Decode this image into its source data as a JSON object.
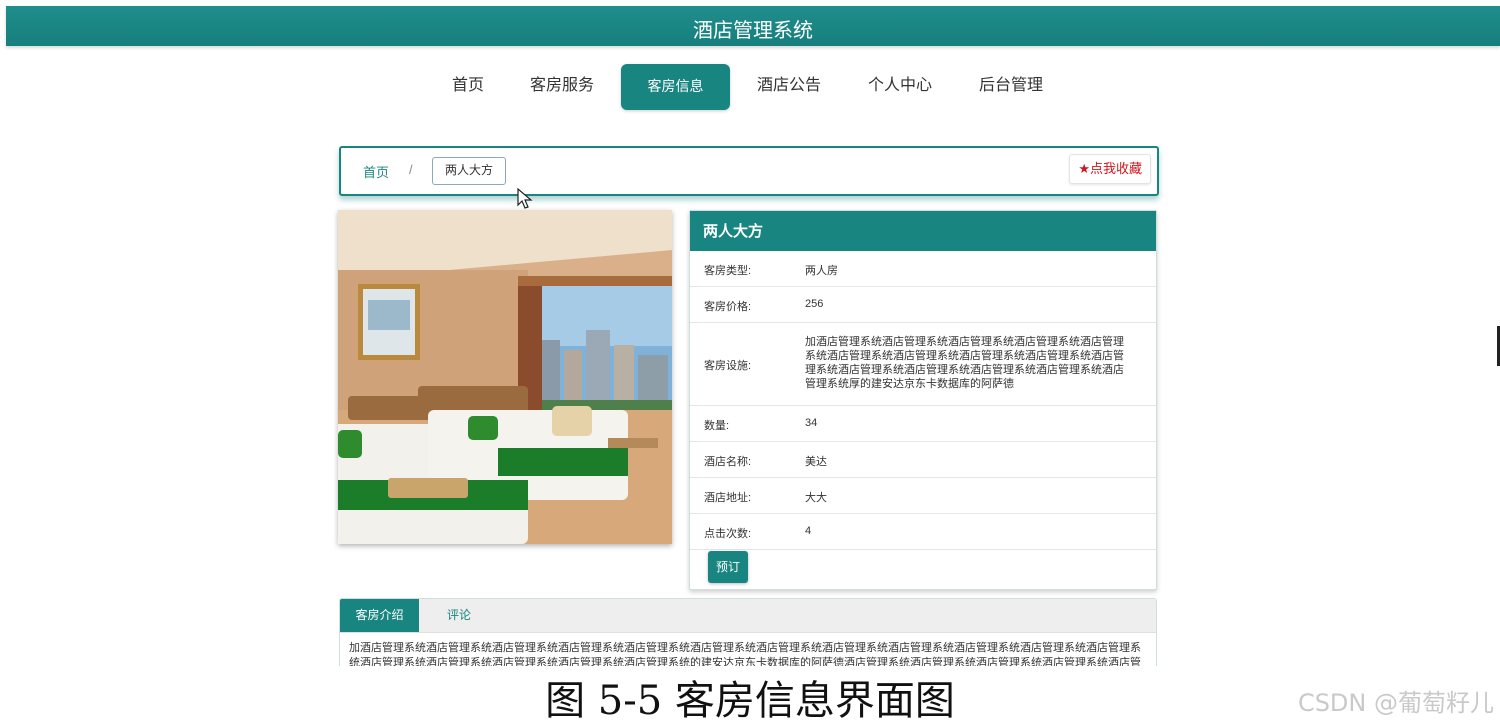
{
  "header": {
    "title": "酒店管理系统"
  },
  "nav": {
    "items": [
      {
        "label": "首页"
      },
      {
        "label": "客房服务"
      },
      {
        "label": "客房信息"
      },
      {
        "label": "酒店公告"
      },
      {
        "label": "个人中心"
      },
      {
        "label": "后台管理"
      }
    ],
    "active_index": 2
  },
  "breadcrumb": {
    "home": "首页",
    "separator": "/",
    "current": "两人大方",
    "favorite_label": "★点我收藏"
  },
  "room": {
    "title": "两人大方",
    "fields": [
      {
        "key": "客房类型:",
        "value": "两人房"
      },
      {
        "key": "客房价格:",
        "value": "256"
      },
      {
        "key": "客房设施:",
        "value": "加酒店管理系统酒店管理系统酒店管理系统酒店管理系统酒店管理系统酒店管理系统酒店管理系统酒店管理系统酒店管理系统酒店管理系统酒店管理系统酒店管理系统酒店管理系统酒店管理系统酒店管理系统厚的建安达京东卡数据库的阿萨德"
      },
      {
        "key": "数量:",
        "value": "34"
      },
      {
        "key": "酒店名称:",
        "value": "美达"
      },
      {
        "key": "酒店地址:",
        "value": "大大"
      },
      {
        "key": "点击次数:",
        "value": "4"
      }
    ],
    "book_label": "预订"
  },
  "tabs": {
    "items": [
      {
        "label": "客房介绍"
      },
      {
        "label": "评论"
      }
    ],
    "intro": "加酒店管理系统酒店管理系统酒店管理系统酒店管理系统酒店管理系统酒店管理系统酒店管理系统酒店管理系统酒店管理系统酒店管理系统酒店管理系统酒店管理系统酒店管理系统酒店管理系统酒店管理系统酒店管理系统酒店管理系统的建安达京东卡数据库的阿萨德酒店管理系统酒店管理系统酒店管理系统酒店管理系统酒店管理系统"
  },
  "caption": "图 5-5 客房信息界面图",
  "watermark": "CSDN @葡萄籽儿",
  "colors": {
    "primary": "#198580",
    "favorite": "#d0151d"
  }
}
